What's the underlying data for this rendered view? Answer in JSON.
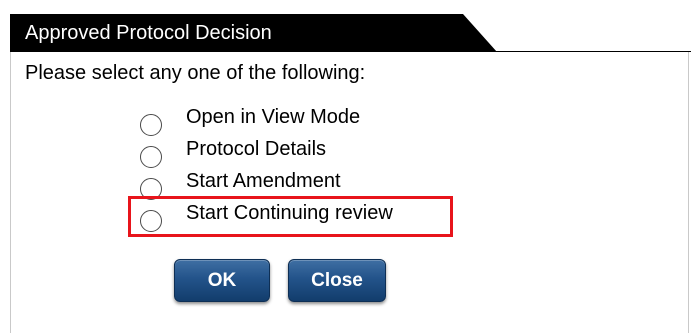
{
  "dialog": {
    "title": "Approved Protocol Decision",
    "prompt": "Please select any one of the following:",
    "options": [
      {
        "label": "Open in View Mode",
        "selected": false
      },
      {
        "label": "Protocol Details",
        "selected": false
      },
      {
        "label": "Start Amendment",
        "selected": false
      },
      {
        "label": "Start Continuing review",
        "selected": false,
        "highlighted": true
      }
    ],
    "buttons": {
      "ok_label": "OK",
      "close_label": "Close"
    }
  },
  "colors": {
    "title_bar": "#000000",
    "title_text": "#ffffff",
    "highlight": "#e8141b",
    "button": "#23538a"
  }
}
